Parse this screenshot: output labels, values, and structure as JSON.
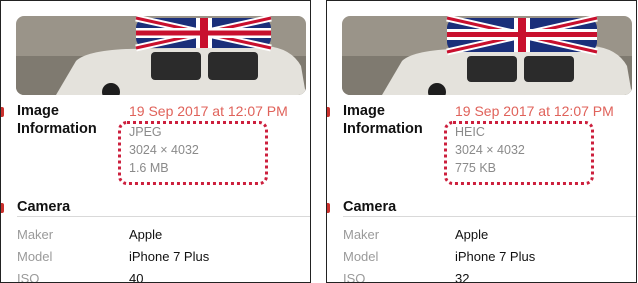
{
  "panels": [
    {
      "section_image_info": {
        "title_line1": "Image",
        "title_line2": "Information"
      },
      "timestamp": "19 Sep 2017 at 12:07 PM",
      "format": "JPEG",
      "dimensions": "3024 × 4032",
      "size": "1.6 MB",
      "section_camera": "Camera",
      "rows": [
        {
          "label": "Maker",
          "value": "Apple"
        },
        {
          "label": "Model",
          "value": "iPhone 7 Plus"
        },
        {
          "label": "ISO",
          "value": "40"
        }
      ]
    },
    {
      "section_image_info": {
        "title_line1": "Image",
        "title_line2": "Information"
      },
      "timestamp": "19 Sep 2017 at 12:07 PM",
      "format": "HEIC",
      "dimensions": "3024 × 4032",
      "size": "775 KB",
      "section_camera": "Camera",
      "rows": [
        {
          "label": "Maker",
          "value": "Apple"
        },
        {
          "label": "Model",
          "value": "iPhone 7 Plus"
        },
        {
          "label": "ISO",
          "value": "32"
        }
      ]
    }
  ],
  "colors": {
    "accent_red": "#e0625a",
    "highlight_box": "#cc1f3d",
    "label_gray": "#9a9a9a"
  }
}
